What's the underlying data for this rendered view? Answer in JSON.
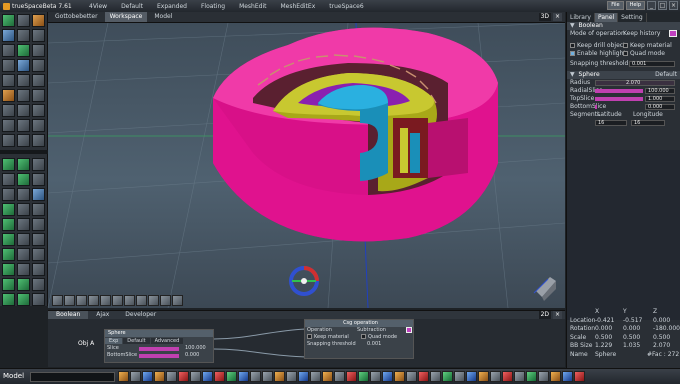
{
  "window": {
    "title": "trueSpaceBeta 7.61",
    "tabs": [
      "4View",
      "Default",
      "Expanded",
      "Floating",
      "MeshEdit",
      "MeshEditEx",
      "trueSpace6"
    ],
    "file_label": "File",
    "help_label": "Help"
  },
  "viewport": {
    "tabs": [
      "Gottobebetter",
      "Workspace",
      "Model"
    ],
    "active_tab_index": 1,
    "mode_label": "3D"
  },
  "right_panel": {
    "tabs": [
      "Library",
      "Panel",
      "Setting"
    ],
    "boolean": {
      "title": "Boolean",
      "mode_label": "Mode of operation",
      "keep_history_label": "Keep history",
      "keep_drill_label": "Keep drill object",
      "keep_material_label": "Keep material",
      "enable_highlight_label": "Enable highlight",
      "quad_mode_label": "Quad mode",
      "snapping_label": "Snapping threshold",
      "snapping_value": "0.001"
    },
    "sphere": {
      "title": "Sphere",
      "preset": "Default",
      "radius_label": "Radius",
      "radius_value": "2.070",
      "radial_slice_label": "RadialSlice",
      "radial_slice_value": "100.000",
      "top_slice_label": "TopSlice",
      "top_slice_value": "1.000",
      "bottom_slice_label": "BottomSlice",
      "bottom_slice_value": "0.000",
      "segments_label": "Segments",
      "latitude_label": "Latitude",
      "longitude_label": "Longitude",
      "latitude_value": "16",
      "longitude_value": "16"
    },
    "coords": {
      "headers": [
        "X",
        "Y",
        "Z"
      ],
      "rows": [
        {
          "label": "Location",
          "x": "-0.421",
          "y": "-0.517",
          "z": "0.000"
        },
        {
          "label": "Rotation",
          "x": "0.000",
          "y": "0.000",
          "z": "-180.000"
        },
        {
          "label": "Scale",
          "x": "0.500",
          "y": "0.500",
          "z": "0.500"
        },
        {
          "label": "BB Size",
          "x": "1.229",
          "y": "1.035",
          "z": "2.070"
        }
      ],
      "name_label": "Name",
      "name_value": "Sphere",
      "face_count": "#Fac : 272"
    }
  },
  "bottom_panel": {
    "tabs": [
      "Boolean",
      "Ajax",
      "Developer"
    ],
    "mode_label": "2D",
    "obj_label": "Obj A",
    "sphere_node": {
      "title": "Sphere",
      "tabs": [
        "Exp",
        "Default",
        "Advanced"
      ],
      "slice_label": "Slice",
      "slice_value": "100.000",
      "bottom_slice_label": "BottomSlice",
      "bottom_slice_value": "0.000"
    },
    "csg_node": {
      "title": "Csg operation",
      "operation_label": "Operation",
      "operation_value": "Subtraction",
      "keep_material_label": "Keep material",
      "quad_mode_label": "Quad mode",
      "snapping_label": "Snapping threshold",
      "snapping_value": "0.001"
    }
  },
  "status": {
    "model_label": "Model"
  },
  "colors": {
    "magenta": "#e0108a",
    "olive": "#a8a818",
    "cyan": "#1a8fb8",
    "purple_accent": "#c040c0"
  }
}
